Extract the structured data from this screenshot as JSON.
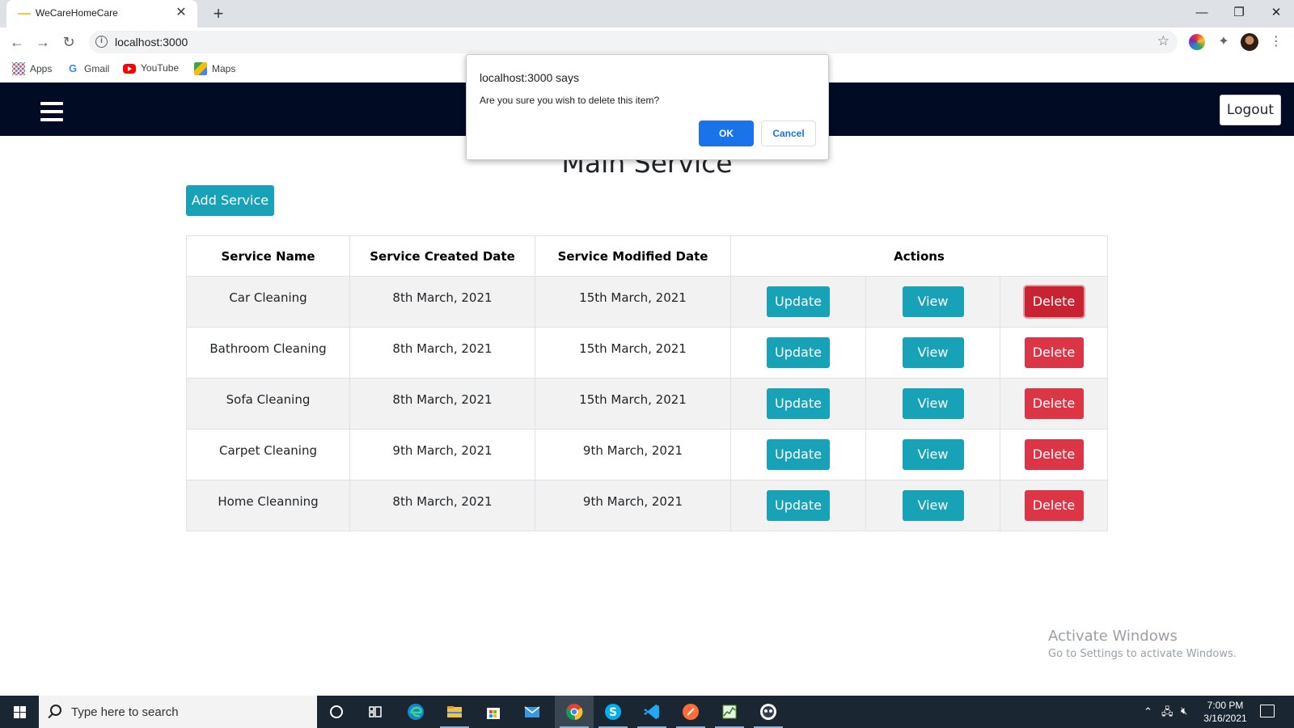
{
  "browser": {
    "tab_title": "WeCareHomeCare",
    "tab_close": "✕",
    "new_tab": "+",
    "url": "localhost:3000",
    "bookmarks": [
      {
        "label": "Apps",
        "icon": "apps-grid-icon"
      },
      {
        "label": "Gmail",
        "icon": "google-icon"
      },
      {
        "label": "YouTube",
        "icon": "youtube-icon"
      },
      {
        "label": "Maps",
        "icon": "maps-icon"
      }
    ]
  },
  "navbar": {
    "logout_label": "Logout"
  },
  "page": {
    "title": "Main Service",
    "add_button_label": "Add Service"
  },
  "table": {
    "headers": [
      "Service Name",
      "Service Created Date",
      "Service Modified Date",
      "Actions"
    ],
    "rows": [
      {
        "name": "Car Cleaning",
        "created": "8th March, 2021",
        "modified": "15th March, 2021"
      },
      {
        "name": "Bathroom Cleaning",
        "created": "8th March, 2021",
        "modified": "15th March, 2021"
      },
      {
        "name": "Sofa Cleaning",
        "created": "8th March, 2021",
        "modified": "15th March, 2021"
      },
      {
        "name": "Carpet Cleaning",
        "created": "9th March, 2021",
        "modified": "9th March, 2021"
      },
      {
        "name": "Home Cleanning",
        "created": "8th March, 2021",
        "modified": "9th March, 2021"
      }
    ],
    "actions": {
      "update": "Update",
      "view": "View",
      "delete": "Delete"
    }
  },
  "dialog": {
    "title": "localhost:3000 says",
    "message": "Are you sure you wish to delete this item?",
    "ok_label": "OK",
    "cancel_label": "Cancel"
  },
  "watermark": {
    "line1": "Activate Windows",
    "line2": "Go to Settings to activate Windows."
  },
  "taskbar": {
    "search_placeholder": "Type here to search",
    "time": "7:00 PM",
    "date": "3/16/2021",
    "apps": [
      "cortana-icon",
      "task-view-icon",
      "edge-icon",
      "file-explorer-icon",
      "store-icon",
      "mail-icon",
      "chrome-icon",
      "skype-icon",
      "vscode-icon",
      "postman-icon",
      "task-manager-icon",
      "app-icon"
    ]
  },
  "colors": {
    "navbar_bg": "#020b24",
    "info_button": "#17a2b8",
    "danger_button": "#dc3545",
    "dialog_primary": "#1a73e8"
  }
}
